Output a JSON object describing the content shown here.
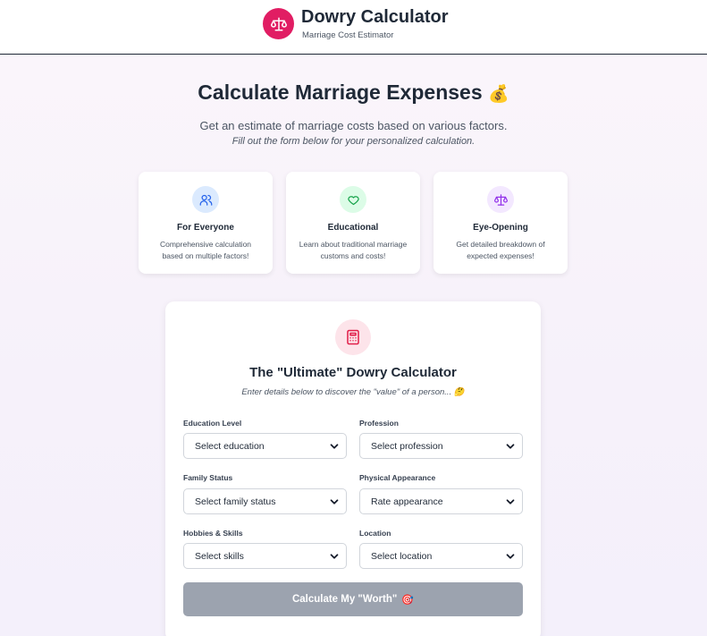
{
  "header": {
    "title": "Dowry Calculator",
    "subtitle": "Marriage Cost Estimator",
    "logo_icon": "scales-icon",
    "accent_color": "#e11d63"
  },
  "hero": {
    "title": "Calculate Marriage Expenses",
    "title_emoji": "💰",
    "description": "Get an estimate of marriage costs based on various factors.",
    "note": "Fill out the form below for your personalized calculation."
  },
  "features": [
    {
      "icon": "users-icon",
      "title": "For Everyone",
      "desc": "Comprehensive calculation based on multiple factors!",
      "icon_bg": "#dbeafe",
      "icon_color": "#2563eb"
    },
    {
      "icon": "heart-icon",
      "title": "Educational",
      "desc": "Learn about traditional marriage customs and costs!",
      "icon_bg": "#dcfce7",
      "icon_color": "#16a34a"
    },
    {
      "icon": "scales-icon",
      "title": "Eye-Opening",
      "desc": "Get detailed breakdown of expected expenses!",
      "icon_bg": "#f3e8ff",
      "icon_color": "#9333ea"
    }
  ],
  "calculator": {
    "icon": "calculator-icon",
    "title": "The \"Ultimate\" Dowry Calculator",
    "subtitle": "Enter details below to discover the \"value\" of a person... 🤔",
    "fields": {
      "education": {
        "label": "Education Level",
        "value": "Select education"
      },
      "profession": {
        "label": "Profession",
        "value": "Select profession"
      },
      "family": {
        "label": "Family Status",
        "value": "Select family status"
      },
      "appearance": {
        "label": "Physical Appearance",
        "value": "Rate appearance"
      },
      "skills": {
        "label": "Hobbies & Skills",
        "value": "Select skills"
      },
      "location": {
        "label": "Location",
        "value": "Select location"
      }
    },
    "button_label": "Calculate My \"Worth\"",
    "button_emoji": "🎯"
  }
}
